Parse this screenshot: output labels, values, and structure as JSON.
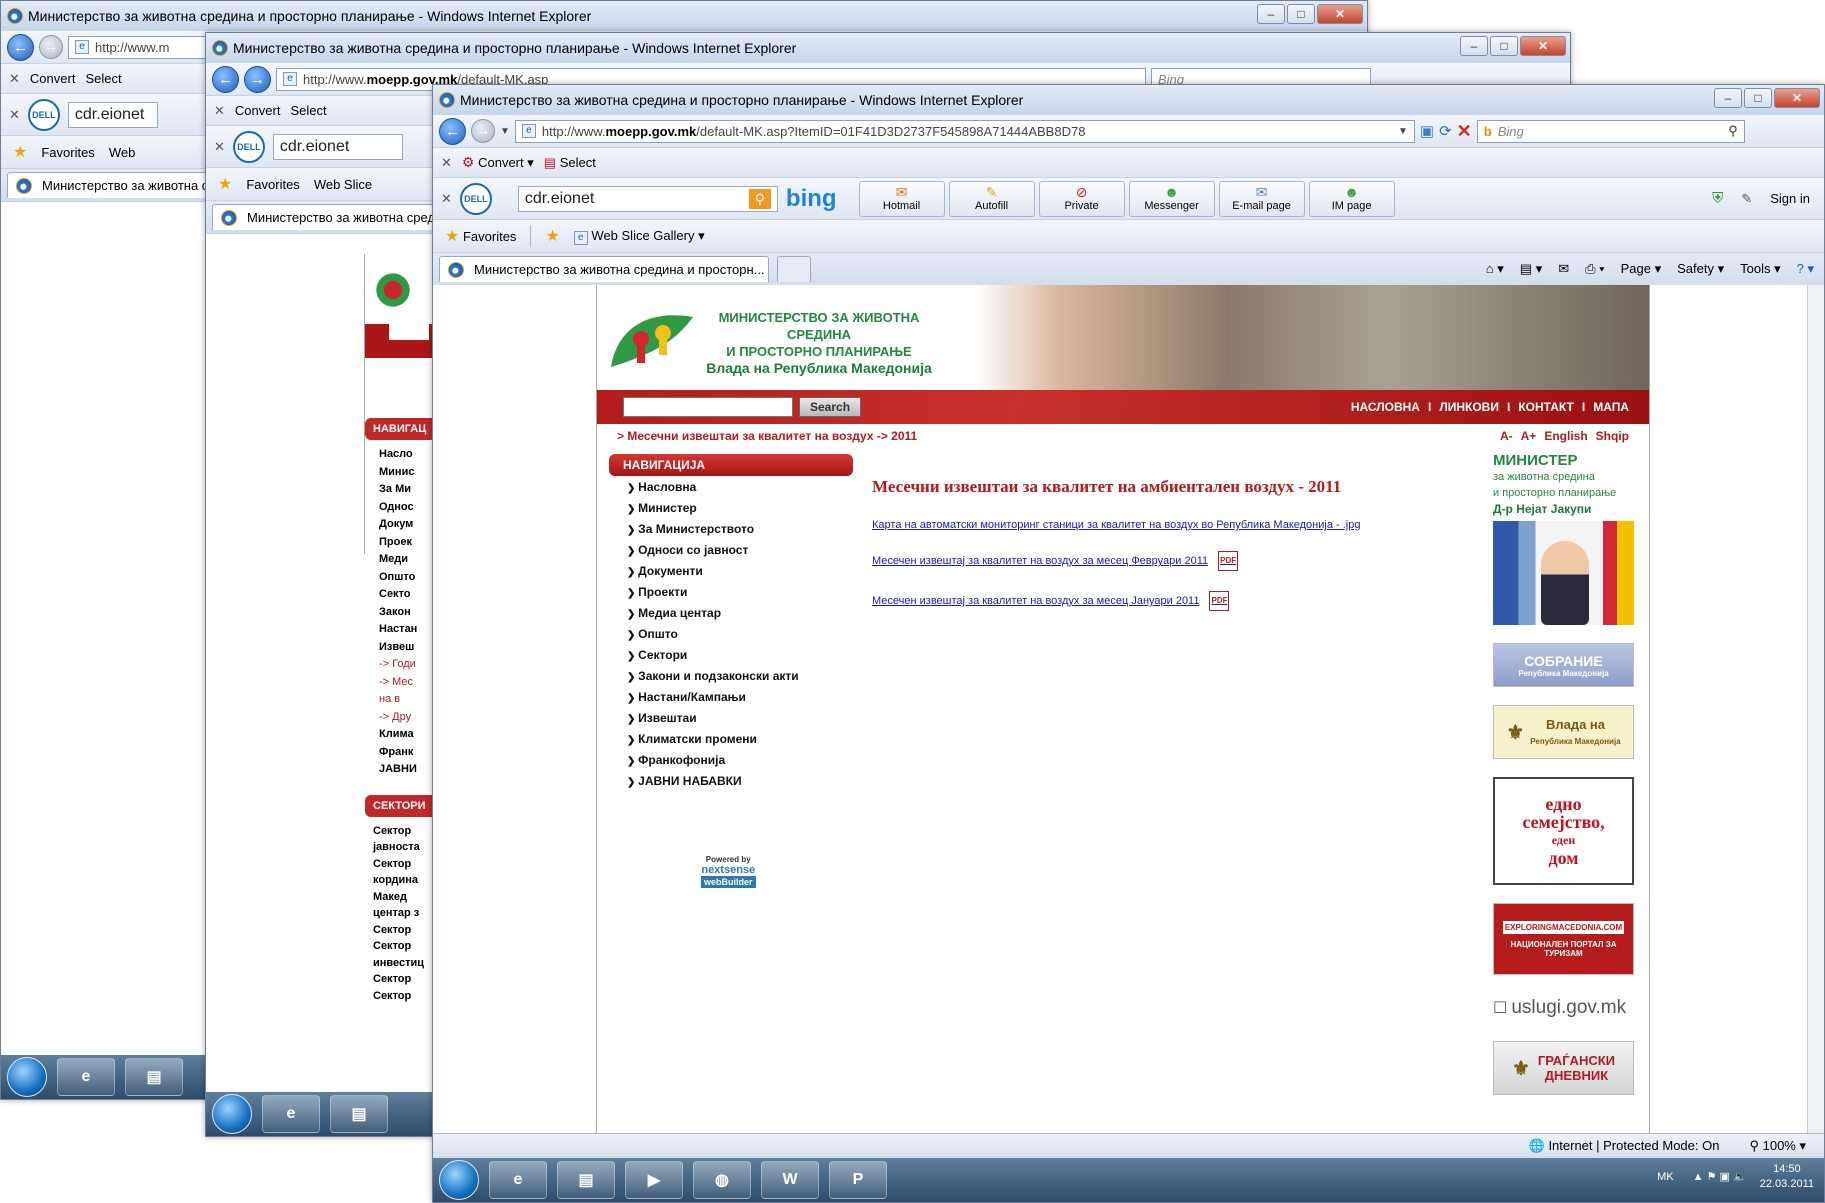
{
  "window_title": "Министерство за животна средина и просторно планирање - Windows Internet Explorer",
  "back_windows": [
    {
      "url_prefix": "http://www.m",
      "convert": "Convert",
      "select": "Select",
      "search_value": "cdr.eionet",
      "favorites": "Favorites",
      "web_slice": "Web",
      "tab_label": "Министерство за животна с"
    },
    {
      "url_prefix": "http://www.",
      "url_bold": "moepp.gov.mk",
      "url_suffix": "/default-MK.asp",
      "convert": "Convert",
      "select": "Select",
      "search_value": "cdr.eionet",
      "favorites": "Favorites",
      "web_slice": "Web Slice",
      "tab_label": "Министерство за животна среди",
      "bing": "Bing",
      "nav_items": [
        "Насло",
        "Минис",
        "За Ми",
        "Однос",
        "Докум",
        "Проек",
        "Меди",
        "Општо",
        "Секто",
        "Закон",
        "Настан",
        "Извеш"
      ],
      "sub_items": [
        "-> Годи",
        "-> Мес",
        "на в",
        "-> Дру"
      ],
      "nav_items2": [
        "Клима",
        "Франк",
        "ЈАВНИ"
      ],
      "nav_header": "НАВИГАЦ",
      "sectors_header": "СЕКТОРИ",
      "sector_items": [
        "Сектор",
        "јавноста",
        "Сектор",
        "кордина",
        "Макед",
        "центар з",
        "Сектор",
        "Сектор",
        "инвестиц",
        "Сектор",
        "Сектор"
      ]
    }
  ],
  "front": {
    "url_prefix": "http://www.",
    "url_bold": "moepp.gov.mk",
    "url_suffix": "/default-MK.asp?ItemID=01F41D3D2737F545898A71444ABB8D78",
    "bing_placeholder": "Bing",
    "convert": "Convert",
    "select": "Select",
    "search_value": "cdr.eionet",
    "bing_logo": "bing",
    "toolbar_buttons": [
      "Hotmail",
      "Autofill",
      "Private",
      "Messenger",
      "E-mail page",
      "IM page"
    ],
    "sign_in": "Sign in",
    "favorites": "Favorites",
    "web_slice": "Web Slice Gallery",
    "tab_label": "Министерство за животна средина и просторн...",
    "cmd": {
      "page": "Page",
      "safety": "Safety",
      "tools": "Tools"
    }
  },
  "site": {
    "logo_line1": "МИНИСТЕРСТВО ЗА ЖИВОТНА СРЕДИНА",
    "logo_line2": "И ПРОСТОРНО ПЛАНИРАЊЕ",
    "logo_line3": "Влада на Република Македонија",
    "search_button": "Search",
    "top_nav": [
      "НАСЛОВНА",
      "ЛИНКОВИ",
      "КОНТАКТ",
      "МАПА"
    ],
    "top_nav_sep": "I",
    "breadcrumb": "> Месечни извештаи за квалитет на воздух -> 2011",
    "font_small": "A-",
    "font_large": "A+",
    "lang_en": "English",
    "lang_sq": "Shqip",
    "nav_header": "НАВИГАЦИЈА",
    "nav_items": [
      "Насловна",
      "Министер",
      "За Министерството",
      "Односи со јавност",
      "Документи",
      "Проекти",
      "Медиа центар",
      "Општо",
      "Сектори",
      "Закони и подзаконски акти",
      "Настани/Кампањи",
      "Извештаи",
      "Климатски промени",
      "Франкофонија",
      "ЈАВНИ НАБАВКИ"
    ],
    "main_title": "Месечни извештаи за квалитет на амбиентален воздух - 2011",
    "links": [
      "Карта на автоматски мониторинг станици за квалитет на воздух во Република Македонија - .jpg",
      "Месечен извештај за квалитет на воздух за месец  Февруари 2011",
      "Месечен извештај за квалитет на воздух за месец  Јануари 2011"
    ],
    "pdf_label": "PDF",
    "powered_by": "Powered by",
    "powered_brand": "nextsense",
    "powered_product": "webBuilder",
    "minister_title": "МИНИСТЕР",
    "minister_sub1": "за животна средина",
    "minister_sub2": "и просторно планирање",
    "minister_name": "Д-р Нејат Јакупи",
    "sobranie": "СОБРАНИЕ",
    "sobranie_sub": "Република Македонија",
    "vlada": "Влада на",
    "vlada_sub": "Република Македонија",
    "family_1": "едно",
    "family_2": "семејство,",
    "family_3": "еден",
    "family_4": "дом",
    "explore_1": "EXPLORINGMACEDONIA.COM",
    "explore_2": "НАЦИОНАЛЕН ПОРТАЛ ЗА ТУРИЗАМ",
    "uslugi": "uslugi.gov.mk",
    "dnevnik_1": "ГРАЃАНСКИ",
    "dnevnik_2": "ДНЕВНИК"
  },
  "status": {
    "zone": "Internet | Protected Mode: On",
    "zoom": "100%"
  },
  "tray": {
    "lang": "MK",
    "time": "14:50",
    "date": "22.03.2011"
  }
}
